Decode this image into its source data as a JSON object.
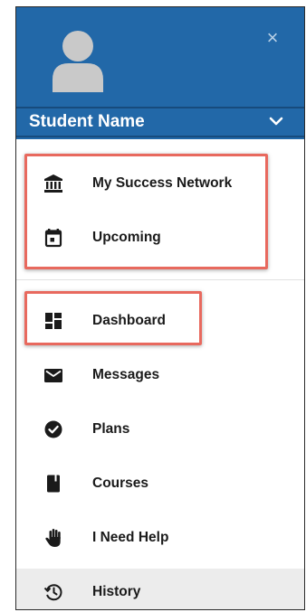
{
  "header": {
    "student_name": "Student Name",
    "close_glyph": "×",
    "background_color": "#2268a8",
    "avatar_icon": "user-avatar-icon",
    "chevron_icon": "chevron-down-icon"
  },
  "network_section": {
    "items": [
      {
        "label": "My Success Network",
        "icon": "institution-icon"
      },
      {
        "label": "Upcoming",
        "icon": "calendar-icon"
      }
    ]
  },
  "nav": {
    "items": [
      {
        "label": "Dashboard",
        "icon": "dashboard-icon"
      },
      {
        "label": "Messages",
        "icon": "envelope-icon"
      },
      {
        "label": "Plans",
        "icon": "check-circle-icon"
      },
      {
        "label": "Courses",
        "icon": "book-icon"
      },
      {
        "label": "I Need Help",
        "icon": "raised-hand-icon"
      },
      {
        "label": "History",
        "icon": "history-icon",
        "active": true
      }
    ]
  },
  "highlight_color": "#e8695e"
}
